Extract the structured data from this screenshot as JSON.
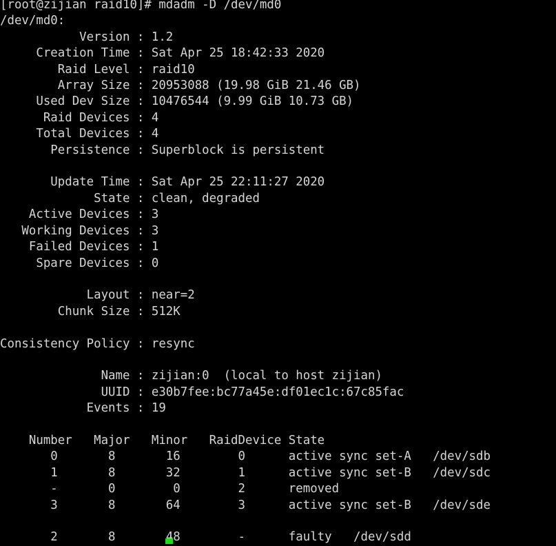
{
  "terminal": {
    "background_color": "#000000",
    "foreground_color": "#d6d6d6",
    "cursor_color": "#1cdc1c",
    "prompt_line": "[root@zijian raid10]# mdadm -D /dev/md0",
    "prompt": {
      "user": "root",
      "host": "zijian",
      "cwd": "raid10",
      "symbol": "#",
      "command": "mdadm -D /dev/md0"
    },
    "output": {
      "device_header": "/dev/md0:",
      "details": [
        {
          "key": "Version",
          "value": "1.2"
        },
        {
          "key": "Creation Time",
          "value": "Sat Apr 25 18:42:33 2020"
        },
        {
          "key": "Raid Level",
          "value": "raid10"
        },
        {
          "key": "Array Size",
          "value": "20953088 (19.98 GiB 21.46 GB)"
        },
        {
          "key": "Used Dev Size",
          "value": "10476544 (9.99 GiB 10.73 GB)"
        },
        {
          "key": "Raid Devices",
          "value": "4"
        },
        {
          "key": "Total Devices",
          "value": "4"
        },
        {
          "key": "Persistence",
          "value": "Superblock is persistent"
        },
        {
          "key": "Update Time",
          "value": "Sat Apr 25 22:11:27 2020"
        },
        {
          "key": "State",
          "value": "clean, degraded"
        },
        {
          "key": "Active Devices",
          "value": "3"
        },
        {
          "key": "Working Devices",
          "value": "3"
        },
        {
          "key": "Failed Devices",
          "value": "1"
        },
        {
          "key": "Spare Devices",
          "value": "0"
        },
        {
          "key": "Layout",
          "value": "near=2"
        },
        {
          "key": "Chunk Size",
          "value": "512K"
        },
        {
          "key": "Consistency Policy",
          "value": "resync"
        },
        {
          "key": "Name",
          "value": "zijian:0  (local to host zijian)"
        },
        {
          "key": "UUID",
          "value": "e30b7fee:bc77a45e:df01ec1c:67c85fac"
        },
        {
          "key": "Events",
          "value": "19"
        }
      ],
      "device_table": {
        "headers": [
          "Number",
          "Major",
          "Minor",
          "RaidDevice",
          "State"
        ],
        "rows": [
          {
            "number": "0",
            "major": "8",
            "minor": "16",
            "raiddevice": "0",
            "state": "active sync set-A",
            "device": "/dev/sdb"
          },
          {
            "number": "1",
            "major": "8",
            "minor": "32",
            "raiddevice": "1",
            "state": "active sync set-B",
            "device": "/dev/sdc"
          },
          {
            "number": "-",
            "major": "0",
            "minor": "0",
            "raiddevice": "2",
            "state": "removed",
            "device": ""
          },
          {
            "number": "3",
            "major": "8",
            "minor": "64",
            "raiddevice": "3",
            "state": "active sync set-B",
            "device": "/dev/sde"
          },
          {
            "number": "2",
            "major": "8",
            "minor": "48",
            "raiddevice": "-",
            "state": "faulty",
            "device": "/dev/sdd"
          }
        ]
      }
    },
    "lines": [
      "[root@zijian raid10]# mdadm -D /dev/md0",
      "/dev/md0:",
      "           Version : 1.2",
      "     Creation Time : Sat Apr 25 18:42:33 2020",
      "        Raid Level : raid10",
      "        Array Size : 20953088 (19.98 GiB 21.46 GB)",
      "     Used Dev Size : 10476544 (9.99 GiB 10.73 GB)",
      "      Raid Devices : 4",
      "     Total Devices : 4",
      "       Persistence : Superblock is persistent",
      "",
      "       Update Time : Sat Apr 25 22:11:27 2020",
      "             State : clean, degraded",
      "    Active Devices : 3",
      "   Working Devices : 3",
      "    Failed Devices : 1",
      "     Spare Devices : 0",
      "",
      "            Layout : near=2",
      "        Chunk Size : 512K",
      "",
      "Consistency Policy : resync",
      "",
      "              Name : zijian:0  (local to host zijian)",
      "              UUID : e30b7fee:bc77a45e:df01ec1c:67c85fac",
      "            Events : 19",
      "",
      "    Number   Major   Minor   RaidDevice State",
      "       0       8       16        0      active sync set-A   /dev/sdb",
      "       1       8       32        1      active sync set-B   /dev/sdc",
      "       -       0        0        2      removed",
      "       3       8       64        3      active sync set-B   /dev/sde",
      "",
      "       2       8       48        -      faulty   /dev/sdd"
    ]
  }
}
